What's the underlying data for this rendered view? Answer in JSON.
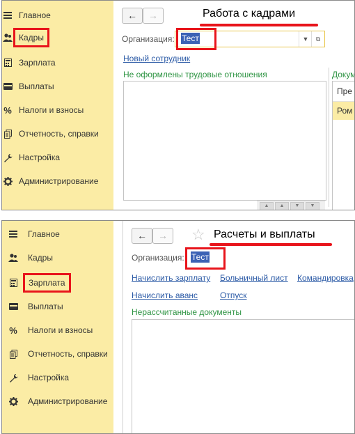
{
  "top": {
    "sidebar": {
      "items": [
        {
          "label": "Главное",
          "icon": "menu-lines-icon"
        },
        {
          "label": "Кадры",
          "icon": "people-icon"
        },
        {
          "label": "Зарплата",
          "icon": "calculator-icon"
        },
        {
          "label": "Выплаты",
          "icon": "wallet-icon"
        },
        {
          "label": "Налоги и взносы",
          "icon": "percent-icon"
        },
        {
          "label": "Отчетность, справки",
          "icon": "documents-icon"
        },
        {
          "label": "Настройка",
          "icon": "wrench-icon"
        },
        {
          "label": "Администрирование",
          "icon": "gear-icon"
        }
      ],
      "highlighted": "Кадры"
    },
    "nav": {
      "back": "←",
      "forward": "→"
    },
    "title": "Работа с кадрами",
    "org_label": "Организация:",
    "org_value": "Тест",
    "links": [
      "Новый сотрудник"
    ],
    "group_title": "Не оформлены трудовые отношения",
    "group_title_right": "Докум",
    "right_list": [
      "Пре",
      "Ром"
    ]
  },
  "bottom": {
    "sidebar": {
      "items": [
        {
          "label": "Главное",
          "icon": "menu-lines-icon"
        },
        {
          "label": "Кадры",
          "icon": "people-icon"
        },
        {
          "label": "Зарплата",
          "icon": "calculator-icon"
        },
        {
          "label": "Выплаты",
          "icon": "wallet-icon"
        },
        {
          "label": "Налоги и взносы",
          "icon": "percent-icon"
        },
        {
          "label": "Отчетность, справки",
          "icon": "documents-icon"
        },
        {
          "label": "Настройка",
          "icon": "wrench-icon"
        },
        {
          "label": "Администрирование",
          "icon": "gear-icon"
        }
      ],
      "highlighted": "Зарплата"
    },
    "nav": {
      "back": "←",
      "forward": "→"
    },
    "title": "Расчеты и выплаты",
    "org_label": "Организация:",
    "org_value": "Тест",
    "links_row1": [
      "Начислить зарплату",
      "Больничный лист",
      "Командировка"
    ],
    "links_row2": [
      "Начислить аванс",
      "Отпуск"
    ],
    "group_title": "Нерассчитанные документы"
  },
  "colors": {
    "sidebar_bg": "#fbeca5",
    "highlight_red": "#e8141b",
    "link_blue": "#2b5aa6",
    "group_green": "#2e9443",
    "selection_blue": "#3b62b5",
    "row_selected": "#fbeca5"
  }
}
